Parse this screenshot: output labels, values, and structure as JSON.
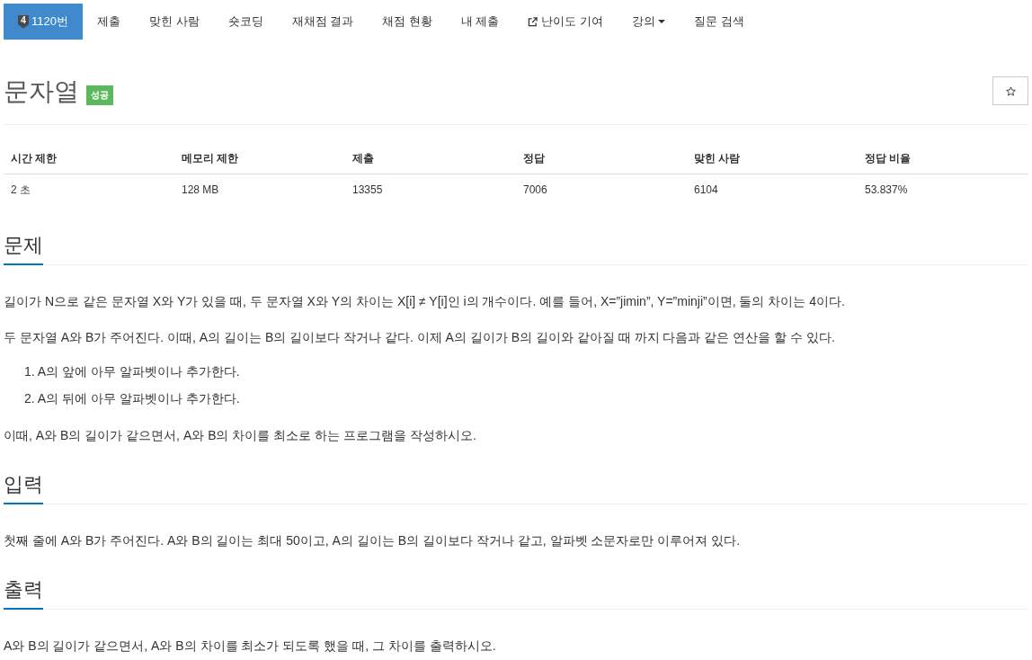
{
  "nav": {
    "tabs": [
      {
        "kind": "problem",
        "tier": "4",
        "label": "1120번",
        "selected": true
      },
      {
        "kind": "link",
        "label": "제출",
        "selected": false
      },
      {
        "kind": "link",
        "label": "맞힌 사람",
        "selected": false
      },
      {
        "kind": "link",
        "label": "숏코딩",
        "selected": false
      },
      {
        "kind": "link",
        "label": "재채점 결과",
        "selected": false
      },
      {
        "kind": "link",
        "label": "채점 현황",
        "selected": false
      },
      {
        "kind": "link",
        "label": "내 제출",
        "selected": false
      },
      {
        "kind": "external",
        "label": "난이도 기여",
        "selected": false
      },
      {
        "kind": "dropdown",
        "label": "강의",
        "selected": false
      },
      {
        "kind": "link",
        "label": "질문 검색",
        "selected": false
      }
    ]
  },
  "problem": {
    "title": "문자열",
    "result": "성공"
  },
  "stats_table": {
    "columns": [
      "시간 제한",
      "메모리 제한",
      "제출",
      "정답",
      "맞힌 사람",
      "정답 비율"
    ],
    "rows": [
      [
        "2 초",
        "128 MB",
        "13355",
        "7006",
        "6104",
        "53.837%"
      ]
    ]
  },
  "sections": [
    {
      "heading": "문제",
      "blocks": [
        {
          "kind": "paragraph",
          "text": "길이가 N으로 같은 문자열 X와 Y가 있을 때, 두 문자열 X와 Y의 차이는 X[i] ≠ Y[i]인 i의 개수이다. 예를 들어, X=”jimin”, Y=”minji”이면, 둘의 차이는 4이다."
        },
        {
          "kind": "paragraph",
          "text": "두 문자열 A와 B가 주어진다. 이때, A의 길이는 B의 길이보다 작거나 같다. 이제 A의 길이가 B의 길이와 같아질 때 까지 다음과 같은 연산을 할 수 있다."
        },
        {
          "kind": "ordered_list",
          "items": [
            {
              "number": "1.",
              "text": "A의 앞에 아무 알파벳이나 추가한다."
            },
            {
              "number": "2.",
              "text": "A의 뒤에 아무 알파벳이나 추가한다."
            }
          ]
        },
        {
          "kind": "paragraph",
          "text": "이때, A와 B의 길이가 같으면서, A와 B의 차이를 최소로 하는 프로그램을 작성하시오."
        }
      ]
    },
    {
      "heading": "입력",
      "blocks": [
        {
          "kind": "paragraph",
          "text": "첫째 줄에 A와 B가 주어진다. A와 B의 길이는 최대 50이고, A의 길이는 B의 길이보다 작거나 같고, 알파벳 소문자로만 이루어져 있다."
        }
      ]
    },
    {
      "heading": "출력",
      "blocks": [
        {
          "kind": "paragraph",
          "text": "A와 B의 길이가 같으면서, A와 B의 차이를 최소가 되도록 했을 때, 그 차이를 출력하시오."
        }
      ]
    }
  ]
}
